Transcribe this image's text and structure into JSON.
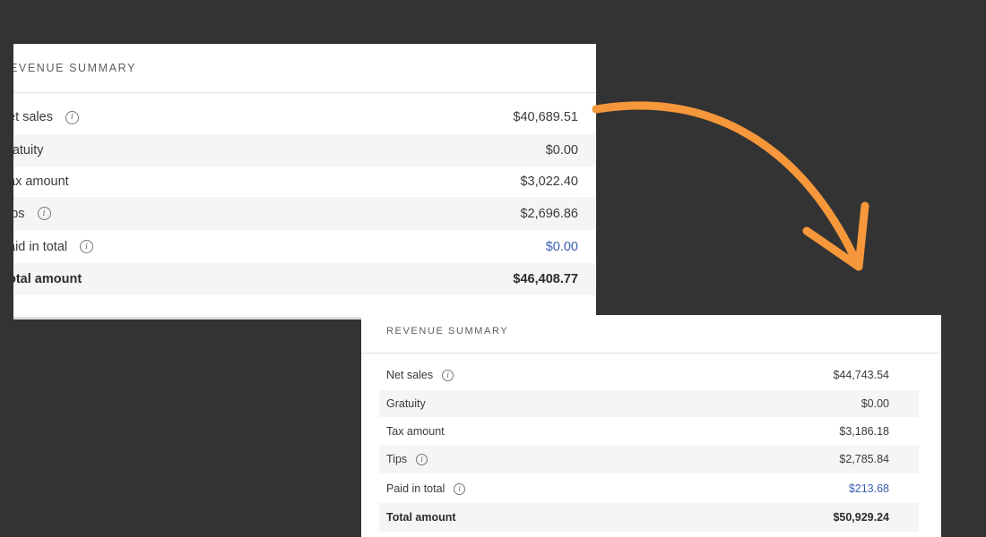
{
  "colors": {
    "background": "#333333",
    "accent_arrow": "#f5973a",
    "link": "#3a5fb3"
  },
  "before": {
    "title": "EVENUE SUMMARY",
    "rows": [
      {
        "label": "et sales",
        "value": "$40,689.51",
        "info": true
      },
      {
        "label": "ratuity",
        "value": "$0.00",
        "info": false
      },
      {
        "label": "ax amount",
        "value": "$3,022.40",
        "info": false
      },
      {
        "label": "ips",
        "value": "$2,696.86",
        "info": true
      },
      {
        "label": "aid in total",
        "value": "$0.00",
        "info": true
      },
      {
        "label": "otal amount",
        "value": "$46,408.77",
        "info": false
      }
    ]
  },
  "after": {
    "title": "REVENUE SUMMARY",
    "rows": [
      {
        "label": "Net sales",
        "value": "$44,743.54",
        "info": true
      },
      {
        "label": "Gratuity",
        "value": "$0.00",
        "info": false
      },
      {
        "label": "Tax amount",
        "value": "$3,186.18",
        "info": false
      },
      {
        "label": "Tips",
        "value": "$2,785.84",
        "info": true
      },
      {
        "label": "Paid in total",
        "value": "$213.68",
        "info": true
      },
      {
        "label": "Total amount",
        "value": "$50,929.24",
        "info": false
      }
    ]
  }
}
